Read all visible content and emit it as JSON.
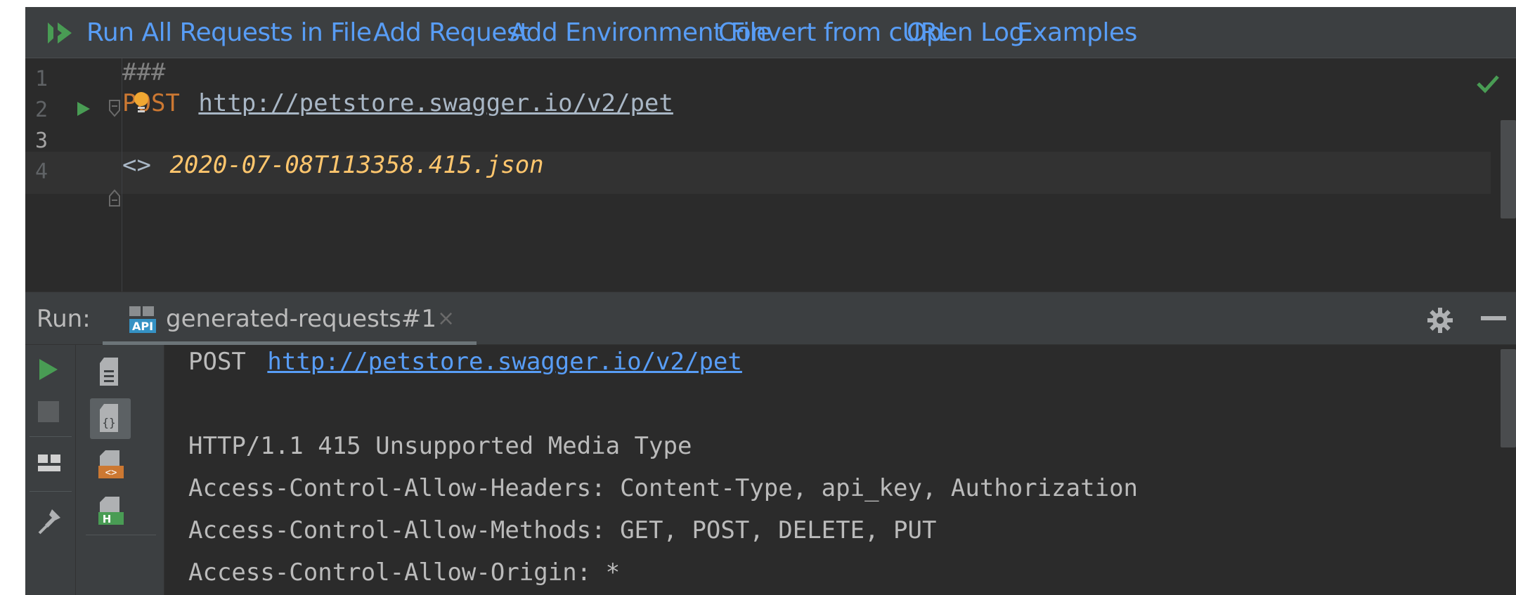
{
  "toolbar": {
    "run_all": "Run All Requests in File",
    "add_request": "Add Request",
    "add_env": "Add Environment File",
    "convert_curl": "Convert from cURL",
    "open_log": "Open Log",
    "examples": "Examples"
  },
  "editor": {
    "line_numbers": [
      "1",
      "2",
      "3",
      "4"
    ],
    "line1": "###",
    "line2_method": "POST",
    "line2_url": "http://petstore.swagger.io/v2/pet",
    "line4_prefix": "<>",
    "line4_file": "2020-07-08T113358.415.json",
    "active_line": "3",
    "status_icon": "check-icon"
  },
  "run_panel": {
    "label": "Run:",
    "tab_label": "generated-requests#1",
    "tab_close": "×",
    "tab_icon": "api-icon"
  },
  "output": {
    "request_method": "POST",
    "request_url": "http://petstore.swagger.io/v2/pet",
    "status_line": "HTTP/1.1 415 Unsupported Media Type",
    "header1": "Access-Control-Allow-Headers: Content-Type, api_key, Authorization",
    "header2": "Access-Control-Allow-Methods: GET, POST, DELETE, PUT",
    "header3": "Access-Control-Allow-Origin: *"
  },
  "colors": {
    "accent_blue": "#589df6",
    "run_green": "#499c54",
    "method_orange": "#cc7832",
    "file_yellow": "#ffc66d"
  }
}
